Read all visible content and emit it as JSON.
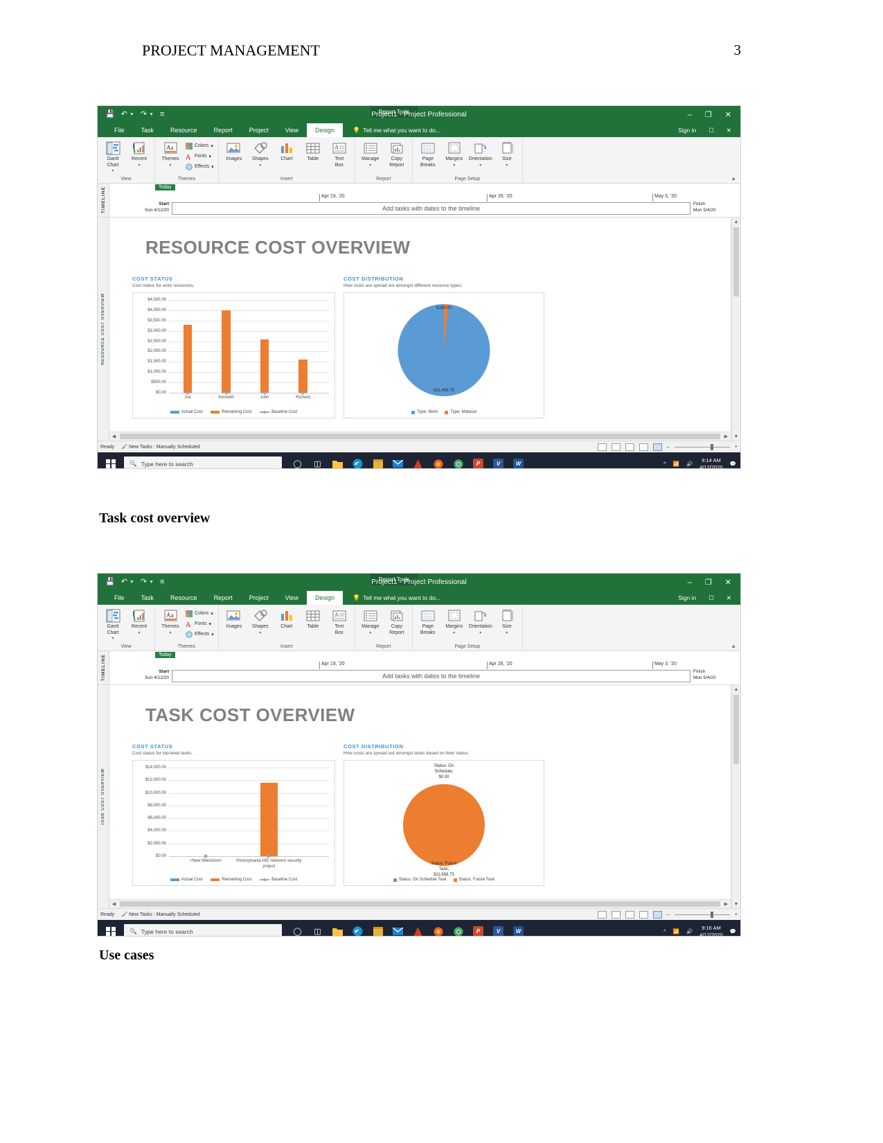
{
  "document": {
    "header_title": "PROJECT MANAGEMENT",
    "page_number": "3",
    "heading_task": "Task cost overview",
    "heading_use": "Use cases"
  },
  "app": {
    "title": "Project1 - Project Professional",
    "contextual_tab_group": "Report Tools",
    "quick_access": [
      "save-icon",
      "undo-icon",
      "redo-icon",
      "customize-icon"
    ],
    "window_controls": {
      "minimize": "–",
      "restore": "❐",
      "close": "✕"
    },
    "tabs": [
      {
        "label": "File",
        "active": false
      },
      {
        "label": "Task",
        "active": false
      },
      {
        "label": "Resource",
        "active": false
      },
      {
        "label": "Report",
        "active": false
      },
      {
        "label": "Project",
        "active": false
      },
      {
        "label": "View",
        "active": false
      },
      {
        "label": "Design",
        "active": true
      }
    ],
    "tell_me": "Tell me what you want to do...",
    "sign_in": "Sign in",
    "ribbon_groups": [
      {
        "label": "View",
        "buttons": [
          {
            "caption": "Gantt\nChart",
            "icon": "gantt-chart-icon",
            "caret": true
          },
          {
            "caption": "Recent",
            "icon": "recent-reports-icon",
            "caret": true
          }
        ]
      },
      {
        "label": "Themes",
        "buttons": [
          {
            "caption": "Themes",
            "icon": "themes-icon",
            "caret": true
          }
        ],
        "small_buttons": [
          {
            "caption": "Colors",
            "icon": "colors-icon"
          },
          {
            "caption": "Fonts",
            "icon": "fonts-icon"
          },
          {
            "caption": "Effects",
            "icon": "effects-icon"
          }
        ]
      },
      {
        "label": "Insert",
        "buttons": [
          {
            "caption": "Images",
            "icon": "images-icon",
            "caret": false
          },
          {
            "caption": "Shapes",
            "icon": "shapes-icon",
            "caret": true
          },
          {
            "caption": "Chart",
            "icon": "chart-icon",
            "caret": false
          },
          {
            "caption": "Table",
            "icon": "table-icon",
            "caret": false
          },
          {
            "caption": "Text\nBox",
            "icon": "text-box-icon",
            "caret": false
          }
        ]
      },
      {
        "label": "Report",
        "buttons": [
          {
            "caption": "Manage",
            "icon": "manage-icon",
            "caret": true
          },
          {
            "caption": "Copy\nReport",
            "icon": "copy-report-icon",
            "caret": false
          }
        ]
      },
      {
        "label": "Page Setup",
        "buttons": [
          {
            "caption": "Page\nBreaks",
            "icon": "page-breaks-icon",
            "caret": false
          },
          {
            "caption": "Margins",
            "icon": "margins-icon",
            "caret": true
          },
          {
            "caption": "Orientation",
            "icon": "orientation-icon",
            "caret": true
          },
          {
            "caption": "Size",
            "icon": "size-icon",
            "caret": true
          }
        ]
      }
    ],
    "timeline": {
      "vertical_tab": "TIMELINE",
      "today_label": "Today",
      "ticks": [
        "Apr 19, '20",
        "Apr 26, '20",
        "May 3, '20"
      ],
      "start_label": "Start",
      "start_date": "Sun 4/12/20",
      "finish_label": "Finish",
      "finish_date": "Mon 5/4/20",
      "placeholder": "Add tasks with dates to the timeline"
    },
    "status_bar": {
      "ready": "Ready",
      "new_tasks": "New Tasks : Manually Scheduled",
      "zoom_out": "–",
      "zoom_in": "+"
    },
    "taskbar": {
      "search_placeholder": "Type here to search",
      "time1": "9:14 AM",
      "date1": "4/12/2020",
      "time2": "9:16 AM",
      "date2": "4/12/2020",
      "apps": [
        "cortana-icon",
        "task-view-icon",
        "file-explorer-icon",
        "edge-icon",
        "store-icon",
        "mail-icon",
        "adobe-reader-icon",
        "firefox-icon",
        "chrome-icon",
        "powerpoint-icon",
        "visio-icon",
        "word-icon"
      ],
      "tray": [
        "chevron-up-icon",
        "network-icon",
        "volume-icon",
        "notifications-icon"
      ]
    }
  },
  "report1": {
    "vertical_tab": "RESOURCE COST OVERVIEW",
    "title": "RESOURCE COST OVERVIEW",
    "panels": {
      "cost_status": {
        "title": "COST STATUS",
        "subtitle": "Cost status for work resources."
      },
      "cost_distribution": {
        "title": "COST DISTRIBUTION",
        "subtitle": "How costs are spread out amongst different resource types."
      }
    }
  },
  "report2": {
    "vertical_tab": "TASK COST OVERVIEW",
    "title": "TASK COST OVERVIEW",
    "panels": {
      "cost_status": {
        "title": "COST STATUS",
        "subtitle": "Cost status for top-level tasks."
      },
      "cost_distribution": {
        "title": "COST DISTRIBUTION",
        "subtitle": "How costs are spread out amongst tasks based on their status."
      }
    }
  },
  "chart_data": [
    {
      "id": "resource-cost-status",
      "type": "bar",
      "title": "COST STATUS",
      "subtitle": "Cost status for work resources.",
      "categories": [
        "Joe",
        "Kenneth",
        "John",
        "Richard"
      ],
      "series": [
        {
          "name": "Actual Cost",
          "color": "#5b9bd5",
          "values": [
            0,
            0,
            0,
            0
          ]
        },
        {
          "name": "Remaining Cost",
          "color": "#ed7d31",
          "values": [
            3300,
            4000,
            2600,
            1600
          ]
        },
        {
          "name": "Baseline Cost",
          "color": "#a5a5a5",
          "values": [
            0,
            0,
            0,
            0
          ]
        }
      ],
      "ylabel": "",
      "xlabel": "",
      "ylim": [
        0,
        4500
      ],
      "ytick_labels": [
        "$4,500.00",
        "$4,000.00",
        "$3,500.00",
        "$3,000.00",
        "$2,500.00",
        "$2,000.00",
        "$1,500.00",
        "$1,000.00",
        "$500.00",
        "$0.00"
      ],
      "ytick_values": [
        4500,
        4000,
        3500,
        3000,
        2500,
        2000,
        1500,
        1000,
        500,
        0
      ],
      "grid": true,
      "legend_position": "bottom"
    },
    {
      "id": "resource-cost-distribution",
      "type": "pie",
      "title": "COST DISTRIBUTION",
      "subtitle": "How costs are spread out amongst different resource types.",
      "labels": [
        "Type: Work",
        "Type: Material"
      ],
      "values": [
        11498.75,
        180.0
      ],
      "value_labels": [
        "$11,498.75",
        "$180.00"
      ],
      "colors": [
        "#5b9bd5",
        "#ed7d31"
      ],
      "legend_position": "bottom"
    },
    {
      "id": "task-cost-status",
      "type": "bar",
      "title": "COST STATUS",
      "subtitle": "Cost status for top-level tasks.",
      "categories": [
        "<New Milestone>",
        "Pennsylvania HIE networm security project"
      ],
      "series": [
        {
          "name": "Actual Cost",
          "color": "#5b9bd5",
          "values": [
            0,
            0
          ]
        },
        {
          "name": "Remaining Cost",
          "color": "#ed7d31",
          "values": [
            0,
            11600
          ]
        },
        {
          "name": "Baseline Cost",
          "color": "#a5a5a5",
          "values": [
            0,
            0
          ]
        }
      ],
      "ylabel": "",
      "xlabel": "",
      "ylim": [
        0,
        14000
      ],
      "ytick_labels": [
        "$14,000.00",
        "$12,000.00",
        "$10,000.00",
        "$8,000.00",
        "$6,000.00",
        "$4,000.00",
        "$2,000.00",
        "$0.00"
      ],
      "ytick_values": [
        14000,
        12000,
        10000,
        8000,
        6000,
        4000,
        2000,
        0
      ],
      "grid": true,
      "legend_position": "bottom"
    },
    {
      "id": "task-cost-distribution",
      "type": "pie",
      "title": "COST DISTRIBUTION",
      "subtitle": "How costs are spread out amongst tasks based on their status.",
      "labels": [
        "Status: On Schedule Task",
        "Status: Future Task"
      ],
      "values": [
        0.0,
        11658.75
      ],
      "top_label": "Status: On\nSchedule,\n$0.00",
      "bottom_label": "Status: Future\nTask,\n$11,658.75",
      "colors": [
        "#5b9bd5",
        "#ed7d31"
      ],
      "legend_position": "bottom"
    }
  ]
}
